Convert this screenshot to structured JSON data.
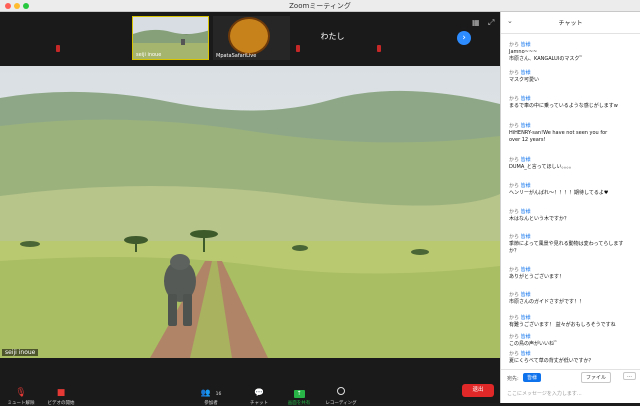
{
  "window": {
    "title": "Zoomミーティング"
  },
  "strip": {
    "tiles": [
      {
        "label": "seiji inoue"
      },
      {
        "label": "MpataSafariLive"
      },
      {
        "label": "わたし"
      }
    ]
  },
  "main_video": {
    "speaker": "seiji inoue"
  },
  "controls": {
    "mute": "ミュート解除",
    "video": "ビデオの開始",
    "participants": "参加者",
    "participants_count": "16",
    "chat": "チャット",
    "share": "画面を共有",
    "record": "レコーディング",
    "end": "退出"
  },
  "chat": {
    "title": "チャット",
    "messages": [
      {
        "from": "から",
        "to": "皆様",
        "lines": [
          "Jamno~~~",
          "市原さん、KANGALUIのマスク ̃ ̃"
        ]
      },
      {
        "from": "から",
        "to": "皆様",
        "lines": [
          "マスク可愛い"
        ]
      },
      {
        "from": "から",
        "to": "皆様",
        "lines": [
          "まるで車の中に乗っているような感じがしますw"
        ]
      },
      {
        "from": "から",
        "to": "皆様",
        "lines": [
          "HiHENRY-san!We have not seen you for",
          "over 12 years!"
        ]
      },
      {
        "from": "から",
        "to": "皆様",
        "lines": [
          "DUMA_と言ってほしい。。。。"
        ]
      },
      {
        "from": "から",
        "to": "皆様",
        "lines": [
          "ヘンリーがんばれ～！！！！期待してるよ♥"
        ]
      },
      {
        "from": "から",
        "to": "皆様",
        "lines": [
          "木はなんという木ですか？"
        ]
      },
      {
        "from": "から",
        "to": "皆様",
        "lines": [
          "季節によって風景や見れる動物は変わってらします",
          "か？"
        ]
      },
      {
        "from": "から",
        "to": "皆様",
        "lines": [
          "ありがとうございます！"
        ]
      },
      {
        "from": "から",
        "to": "皆様",
        "lines": [
          "市原さんのガイドさすがです！！"
        ]
      },
      {
        "from": "から",
        "to": "皆様",
        "lines": [
          "有難うございます！ 益々がおもしろそうですね"
        ]
      },
      {
        "from": "から",
        "to": "皆様",
        "lines": [
          "この鳥の声がいいね ̃ ̃"
        ]
      },
      {
        "from": "から",
        "to": "皆様",
        "lines": [
          "夏にくらべて草の背丈が低いですか？"
        ]
      }
    ],
    "footer": {
      "to_label": "宛先:",
      "to_value": "皆様",
      "file_button": "ファイル",
      "placeholder": "ここにメッセージを入力します..."
    }
  }
}
